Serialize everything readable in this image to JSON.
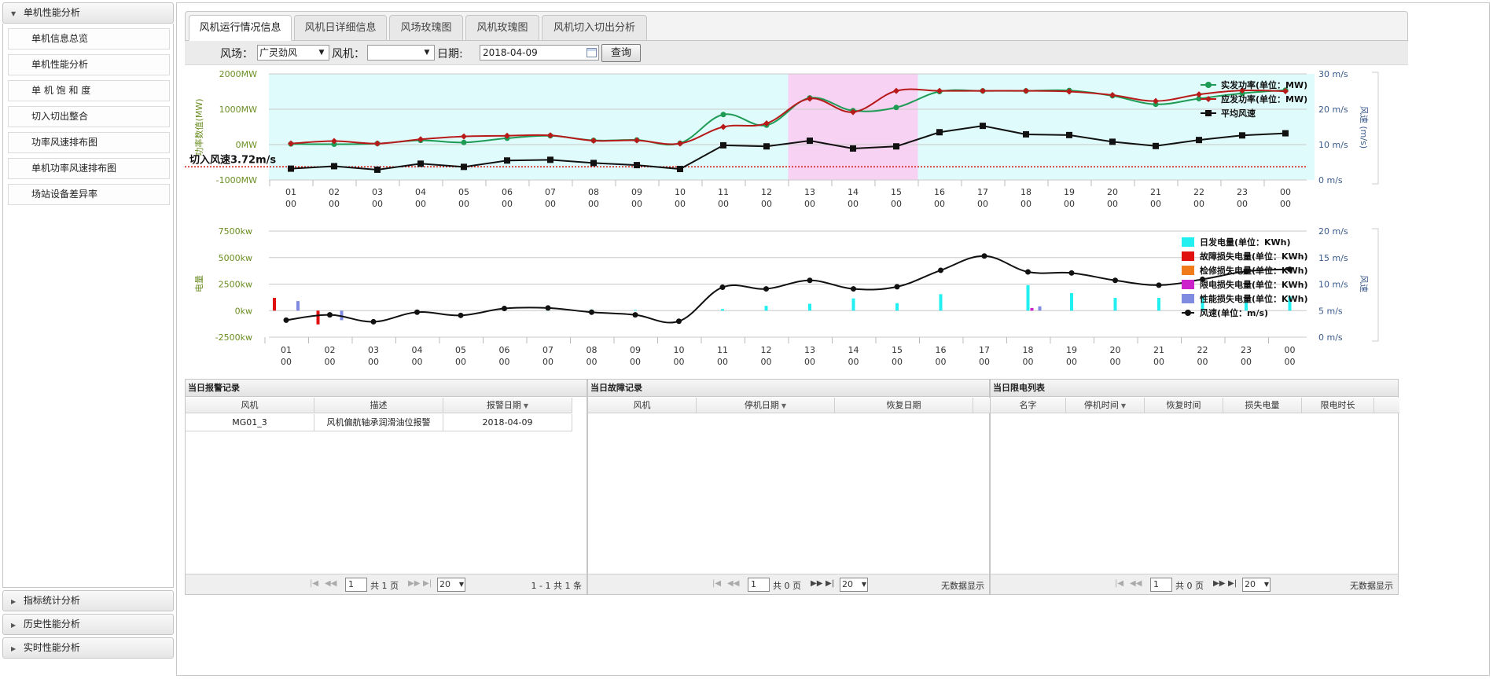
{
  "sidebar": {
    "open_section": "单机性能分析",
    "items": [
      "单机信息总览",
      "单机性能分析",
      "单 机 饱 和 度",
      "切入切出整合",
      "功率风速排布图",
      "单机功率风速排布图",
      "场站设备差异率"
    ],
    "collapsed_sections": [
      "指标统计分析",
      "历史性能分析",
      "实时性能分析"
    ]
  },
  "tabs": [
    "风机运行情况信息",
    "风机日详细信息",
    "风场玫瑰图",
    "风机玫瑰图",
    "风机切入切出分析"
  ],
  "toolbar": {
    "farm_label": "风场：",
    "farm_value": "广灵劲风",
    "turbine_label": "风机：",
    "turbine_value": "",
    "date_label": "日期:",
    "date_value": "2018-04-09",
    "query_label": "查询"
  },
  "chart_data": [
    {
      "type": "line",
      "title": "",
      "x": [
        "01\n00",
        "02\n00",
        "03\n00",
        "04\n00",
        "05\n00",
        "06\n00",
        "07\n00",
        "08\n00",
        "09\n00",
        "10\n00",
        "11\n00",
        "12\n00",
        "13\n00",
        "14\n00",
        "15\n00",
        "16\n00",
        "17\n00",
        "18\n00",
        "19\n00",
        "20\n00",
        "21\n00",
        "22\n00",
        "23\n00",
        "00\n00"
      ],
      "ylabel": "功率数值(MW)",
      "y2label": "风速 (m/s)",
      "y_ticks": [
        "2000MW",
        "1000MW",
        "0MW",
        "-1000MW"
      ],
      "y2_ticks": [
        "30 m/s",
        "20 m/s",
        "10 m/s",
        "0 m/s"
      ],
      "ylim": [
        -1000,
        2000
      ],
      "y2lim": [
        0,
        30
      ],
      "series": [
        {
          "name": "实发功率(单位：MW)",
          "axis": "left",
          "color": "#1e9b55",
          "values": [
            20,
            10,
            30,
            120,
            60,
            180,
            250,
            120,
            130,
            40,
            850,
            550,
            1320,
            960,
            1050,
            1500,
            1520,
            1520,
            1530,
            1380,
            1140,
            1300,
            1450,
            1540
          ]
        },
        {
          "name": "应发功率(单位：MW)",
          "axis": "left",
          "color": "#b81a1a",
          "values": [
            30,
            100,
            30,
            150,
            230,
            250,
            260,
            110,
            120,
            30,
            500,
            600,
            1300,
            920,
            1520,
            1520,
            1520,
            1520,
            1500,
            1400,
            1230,
            1420,
            1530,
            1510
          ]
        },
        {
          "name": "平均风速",
          "axis": "right",
          "color": "#111111",
          "values": [
            3.2,
            3.9,
            2.9,
            4.6,
            3.7,
            5.5,
            5.7,
            4.8,
            4.2,
            3.1,
            9.8,
            9.5,
            11.1,
            8.9,
            9.5,
            13.5,
            15.3,
            12.9,
            12.7,
            10.8,
            9.6,
            11.3,
            12.6,
            13.2
          ]
        }
      ],
      "shaded_regions": [
        {
          "from": "01",
          "to": "00",
          "color": "#dffbfb"
        },
        {
          "from": "13",
          "to": "15",
          "color": "#f7d2f3"
        }
      ],
      "annotation": {
        "text": "切入风速3.72m/s",
        "value": 3.72,
        "axis": "right",
        "color": "#d11111"
      },
      "legend_position": "top-right"
    },
    {
      "type": "bar",
      "title": "",
      "x": [
        "01\n00",
        "02\n00",
        "03\n00",
        "04\n00",
        "05\n00",
        "06\n00",
        "07\n00",
        "08\n00",
        "09\n00",
        "10\n00",
        "11\n00",
        "12\n00",
        "13\n00",
        "14\n00",
        "15\n00",
        "16\n00",
        "17\n00",
        "18\n00",
        "19\n00",
        "20\n00",
        "21\n00",
        "22\n00",
        "23\n00",
        "00\n00"
      ],
      "ylabel": "电量",
      "y2label": "风速",
      "y_ticks": [
        "7500kw",
        "5000kw",
        "2500kw",
        "0kw",
        "-2500kw"
      ],
      "y2_ticks": [
        "20 m/s",
        "15 m/s",
        "10 m/s",
        "5 m/s",
        "0 m/s"
      ],
      "ylim": [
        -2500,
        7500
      ],
      "y2lim": [
        0,
        20
      ],
      "series": [
        {
          "name": "日发电量(单位：KWh)",
          "color": "#22f0f0",
          "values": [
            0,
            0,
            0,
            0,
            0,
            0,
            50,
            100,
            60,
            0,
            150,
            450,
            650,
            1150,
            700,
            1550,
            0,
            2400,
            1650,
            1200,
            1200,
            1300,
            1000,
            1350
          ]
        },
        {
          "name": "故障损失电量(单位：KWh)",
          "color": "#e01010",
          "values": [
            1200,
            -1300,
            0,
            0,
            0,
            0,
            0,
            0,
            0,
            0,
            0,
            0,
            0,
            0,
            0,
            0,
            0,
            0,
            0,
            0,
            0,
            0,
            0,
            0
          ]
        },
        {
          "name": "检修损失电量(单位：KWh)",
          "color": "#f07b1a",
          "values": [
            0,
            0,
            0,
            0,
            0,
            0,
            0,
            0,
            0,
            0,
            0,
            0,
            0,
            0,
            0,
            0,
            0,
            0,
            0,
            0,
            0,
            0,
            0,
            0
          ]
        },
        {
          "name": "限电损失电量(单位：KWh)",
          "color": "#cc22cc",
          "values": [
            0,
            0,
            0,
            0,
            0,
            0,
            0,
            0,
            0,
            0,
            0,
            0,
            0,
            0,
            0,
            0,
            0,
            250,
            0,
            0,
            0,
            0,
            0,
            0
          ]
        },
        {
          "name": "性能损失电量(单位：KWh)",
          "color": "#7f8be0",
          "values": [
            900,
            -900,
            0,
            0,
            0,
            0,
            0,
            0,
            0,
            0,
            0,
            0,
            0,
            0,
            0,
            0,
            0,
            400,
            0,
            0,
            0,
            0,
            0,
            0
          ]
        },
        {
          "name": "风速(单位：m/s)",
          "type": "line",
          "axis": "right",
          "color": "#111111",
          "values": [
            3.2,
            4.2,
            2.9,
            4.7,
            4.1,
            5.4,
            5.5,
            4.7,
            4.2,
            3.0,
            9.4,
            9.1,
            10.7,
            9.1,
            9.5,
            12.6,
            15.3,
            12.3,
            12.1,
            10.7,
            9.8,
            10.9,
            12.4,
            12.8
          ]
        }
      ],
      "legend_position": "top-right"
    }
  ],
  "alarm_panel": {
    "title": "当日报警记录",
    "columns": [
      "风机",
      "描述",
      "报警日期"
    ],
    "rows": [
      [
        "MG01_3",
        "风机偏航轴承润滑油位报警",
        "2018-04-09"
      ]
    ],
    "pager": {
      "page": "1",
      "total_pages": "共 1 页",
      "size": "20",
      "summary": "1 - 1  共 1 条"
    }
  },
  "fault_panel": {
    "title": "当日故障记录",
    "columns": [
      "风机",
      "停机日期",
      "恢复日期"
    ],
    "pager": {
      "page": "1",
      "total_pages": "共 0 页",
      "size": "20",
      "summary": "无数据显示"
    }
  },
  "limit_panel": {
    "title": "当日限电列表",
    "columns": [
      "名字",
      "停机时间",
      "恢复时间",
      "损失电量",
      "限电时长"
    ],
    "pager": {
      "page": "1",
      "total_pages": "共 0 页",
      "size": "20",
      "summary": "无数据显示"
    }
  }
}
